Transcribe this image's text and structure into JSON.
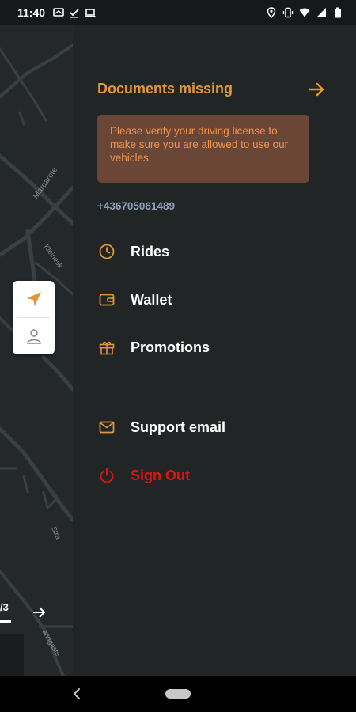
{
  "status_bar": {
    "time": "11:40",
    "left_icons": [
      "cast-icon",
      "download-done-icon",
      "laptop-icon"
    ],
    "right_icons": [
      "location-pin-icon",
      "vibrate-icon",
      "wifi-icon",
      "signal-icon",
      "battery-icon"
    ]
  },
  "map": {
    "street_labels": [
      "Margarete",
      "Kleinesk",
      "Stra",
      "anngaste"
    ]
  },
  "pager": {
    "text": "/3"
  },
  "drawer": {
    "documents_title": "Documents missing",
    "warning_text": "Please verify your driving license to make sure you are allowed to use our vehicles.",
    "phone_number": "+436705061489",
    "menu": [
      {
        "label": "Rides",
        "icon": "clock-icon"
      },
      {
        "label": "Wallet",
        "icon": "wallet-icon"
      },
      {
        "label": "Promotions",
        "icon": "gift-icon"
      },
      {
        "label": "Support email",
        "icon": "mail-icon"
      },
      {
        "label": "Sign Out",
        "icon": "power-icon"
      }
    ]
  },
  "colors": {
    "accent": "#e0973c",
    "warning_bg": "#6a4636",
    "warning_text": "#f0934d",
    "signout": "#e0140f",
    "drawer_bg": "#222526",
    "phone": "#8fa0b8"
  }
}
